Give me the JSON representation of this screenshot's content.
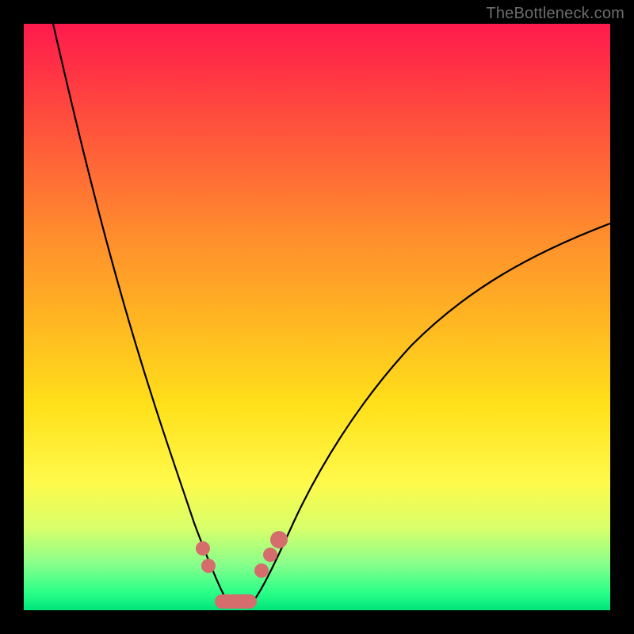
{
  "watermark": {
    "text": "TheBottleneck.com"
  },
  "colors": {
    "dot": "#d56d6d",
    "curve": "#000000",
    "gradient_top": "#ff1a4d",
    "gradient_bottom": "#00e47a"
  },
  "chart_data": {
    "type": "line",
    "title": "",
    "xlabel": "",
    "ylabel": "",
    "xlim": [
      0,
      100
    ],
    "ylim": [
      0,
      100
    ],
    "grid": false,
    "legend": false,
    "note": "Axes unlabeled; values are visual estimates from the plot area (0=left/bottom, 100=right/top).",
    "series": [
      {
        "name": "left-curve",
        "x": [
          5,
          10,
          15,
          20,
          25,
          27,
          29,
          31,
          33,
          34.5
        ],
        "values": [
          100,
          80,
          58,
          38,
          20,
          14,
          9,
          5,
          2.5,
          1.5
        ]
      },
      {
        "name": "right-curve",
        "x": [
          39,
          41,
          44,
          48,
          55,
          65,
          78,
          90,
          100
        ],
        "values": [
          2,
          5,
          10,
          17,
          28,
          40,
          52,
          60,
          66
        ]
      }
    ],
    "markers": [
      {
        "name": "left-dot-upper",
        "x": 30.5,
        "y": 10.5,
        "size": "big"
      },
      {
        "name": "left-dot-lower",
        "x": 31.5,
        "y": 7.5,
        "size": "big"
      },
      {
        "name": "right-dot-1",
        "x": 40.5,
        "y": 7.0,
        "size": "big"
      },
      {
        "name": "right-dot-2",
        "x": 42.0,
        "y": 9.5,
        "size": "big"
      },
      {
        "name": "right-dot-3",
        "x": 43.5,
        "y": 12.0,
        "size": "bigger"
      }
    ],
    "trough": {
      "x_start": 33.5,
      "x_end": 38.5,
      "y": 1.6
    }
  }
}
